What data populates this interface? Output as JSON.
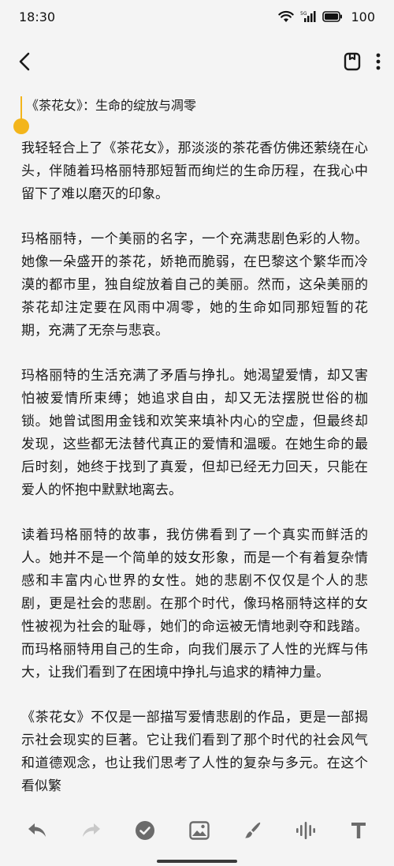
{
  "status_bar": {
    "time": "18:30",
    "battery": "100"
  },
  "note": {
    "title": "《茶花女》：生命的绽放与凋零",
    "paragraphs": [
      "我轻轻合上了《茶花女》，那淡淡的茶花香仿佛还萦绕在心头，伴随着玛格丽特那短暂而绚烂的生命历程，在我心中留下了难以磨灭的印象。",
      "玛格丽特，一个美丽的名字，一个充满悲剧色彩的人物。她像一朵盛开的茶花，娇艳而脆弱，在巴黎这个繁华而冷漠的都市里，独自绽放着自己的美丽。然而，这朵美丽的茶花却注定要在风雨中凋零，她的生命如同那短暂的花期，充满了无奈与悲哀。",
      "玛格丽特的生活充满了矛盾与挣扎。她渴望爱情，却又害怕被爱情所束缚；她追求自由，却又无法摆脱世俗的枷锁。她曾试图用金钱和欢笑来填补内心的空虚，但最终却发现，这些都无法替代真正的爱情和温暖。在她生命的最后时刻，她终于找到了真爱，但却已经无力回天，只能在爱人的怀抱中默默地离去。",
      "读着玛格丽特的故事，我仿佛看到了一个真实而鲜活的人。她并不是一个简单的妓女形象，而是一个有着复杂情感和丰富内心世界的女性。她的悲剧不仅仅是个人的悲剧，更是社会的悲剧。在那个时代，像玛格丽特这样的女性被视为社会的耻辱，她们的命运被无情地剥夺和践踏。而玛格丽特用自己的生命，向我们展示了人性的光辉与伟大，让我们看到了在困境中挣扎与追求的精神力量。",
      "《茶花女》不仅是一部描写爱情悲剧的作品，更是一部揭示社会现实的巨著。它让我们看到了那个时代的社会风气和道德观念，也让我们思考了人性的复杂与多元。在这个看似繁"
    ]
  },
  "icons": {
    "back": "back-arrow-icon",
    "bookmark": "bookmark-icon",
    "more": "more-vertical-icon",
    "undo": "undo-icon",
    "redo": "redo-icon",
    "checklist": "check-circle-icon",
    "image": "image-icon",
    "brush": "brush-icon",
    "audio": "audio-wave-icon",
    "text": "text-format-icon"
  },
  "colors": {
    "accent": "#f3b51b",
    "background": "#f4f4f4",
    "icon_active": "#6b6b6b",
    "icon_disabled": "#c8c8c8"
  }
}
